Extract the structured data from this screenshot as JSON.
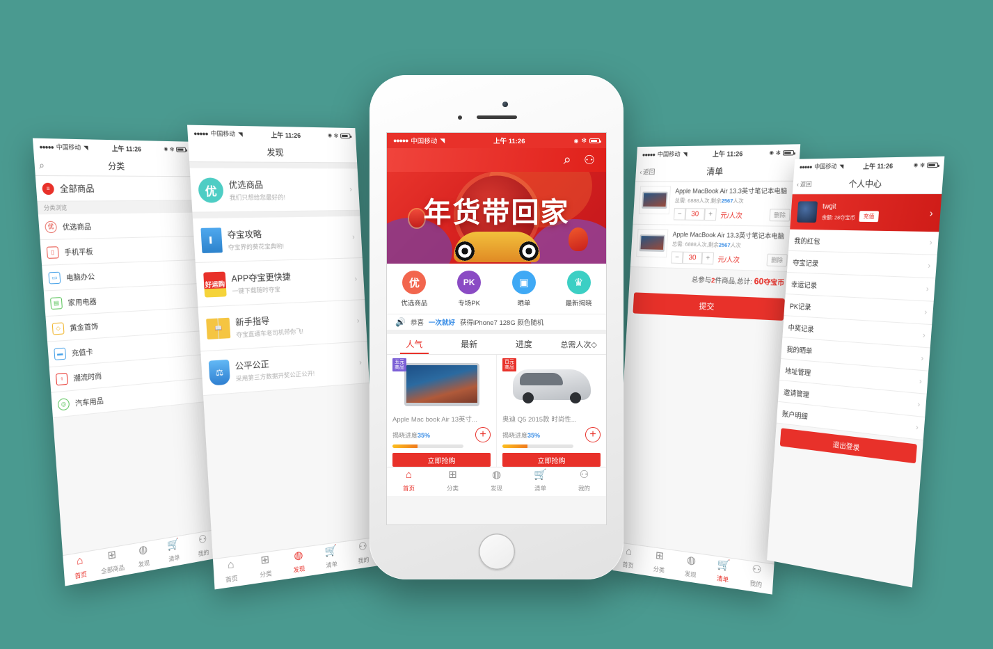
{
  "background_color": "#4a9a90",
  "accent_color": "#e8312a",
  "status_bar": {
    "signal_dots": "●●●●●",
    "carrier": "中国移动",
    "wifi_icon": "wifi-icon",
    "time": "上午 11:26",
    "alarm_icon": "alarm-icon",
    "bluetooth_icon": "bluetooth-icon",
    "battery_icon": "battery-icon"
  },
  "screen_category": {
    "title": "分类",
    "search_icon": "search-icon",
    "all_products": {
      "label": "全部商品",
      "icon": "list-icon"
    },
    "section_header": "分类浏览",
    "items": [
      {
        "label": "优选商品",
        "icon": "you-badge-icon",
        "color": "#e8726a"
      },
      {
        "label": "手机平板",
        "icon": "phone-icon",
        "color": "#e8554a"
      },
      {
        "label": "电脑办公",
        "icon": "monitor-icon",
        "color": "#4aa3e8"
      },
      {
        "label": "家用电器",
        "icon": "appliance-icon",
        "color": "#5cc45c"
      },
      {
        "label": "黄金首饰",
        "icon": "diamond-icon",
        "color": "#f0b429"
      },
      {
        "label": "充值卡",
        "icon": "card-icon",
        "color": "#4aa3e8"
      },
      {
        "label": "潮流时尚",
        "icon": "fashion-icon",
        "color": "#e8312a"
      },
      {
        "label": "汽车用品",
        "icon": "wheel-icon",
        "color": "#5cc45c"
      }
    ],
    "tabbar": [
      {
        "label": "首页",
        "icon": "home-icon",
        "active": true
      },
      {
        "label": "全部商品",
        "icon": "grid-icon",
        "active": false
      },
      {
        "label": "发现",
        "icon": "discover-icon",
        "active": false
      },
      {
        "label": "清单",
        "icon": "cart-icon",
        "active": false
      },
      {
        "label": "我的",
        "icon": "person-icon",
        "active": false
      }
    ]
  },
  "screen_discover": {
    "title": "发现",
    "items": [
      {
        "title": "优选商品",
        "subtitle": "我们只想给您最好的!",
        "icon": "you-circle-icon",
        "color": "#4ecdc4"
      },
      {
        "title": "夺宝攻略",
        "subtitle": "夺宝界的葵花宝典哟!",
        "icon": "book-icon",
        "color": "#3d9be9"
      },
      {
        "title": "APP夺宝更快捷",
        "subtitle": "一键下载随时夺宝",
        "icon": "app-icon",
        "color": "#e8312a"
      },
      {
        "title": "新手指导",
        "subtitle": "夺宝直通车老司机带你飞!",
        "icon": "open-book-icon",
        "color": "#f0b429"
      },
      {
        "title": "公平公正",
        "subtitle": "采用第三方数据开奖公正公开!",
        "icon": "shield-scale-icon",
        "color": "#3d9be9"
      }
    ],
    "tabbar": [
      {
        "label": "首页",
        "icon": "home-icon",
        "active": false
      },
      {
        "label": "分类",
        "icon": "grid-icon",
        "active": false
      },
      {
        "label": "发现",
        "icon": "discover-icon",
        "active": true
      },
      {
        "label": "清单",
        "icon": "cart-icon",
        "active": false
      },
      {
        "label": "我的",
        "icon": "person-icon",
        "active": false
      }
    ]
  },
  "screen_home": {
    "search_icon": "search-icon",
    "account_icon": "person-icon",
    "banner": {
      "title": "年货带回家",
      "lantern_icon": "lantern-icon",
      "rooster_icon": "rooster-icon",
      "lion_icon": "lion-mask-icon"
    },
    "quick_links": [
      {
        "label": "优选商品",
        "glyph": "优",
        "color": "#f2664e",
        "icon": "you-circle-icon"
      },
      {
        "label": "专场PK",
        "glyph": "PK",
        "color": "#8a4bc4",
        "icon": "pk-circle-icon"
      },
      {
        "label": "晒单",
        "glyph": "▣",
        "color": "#3fa9f5",
        "icon": "photo-circle-icon"
      },
      {
        "label": "最新揭晓",
        "glyph": "♛",
        "color": "#3ccfc4",
        "icon": "crown-circle-icon"
      }
    ],
    "notice": {
      "speaker_icon": "speaker-icon",
      "prefix": "恭喜",
      "highlight": "一次就好",
      "suffix": "获得iPhone7 128G 颜色随机"
    },
    "tabs": [
      {
        "label": "人气",
        "active": true
      },
      {
        "label": "最新",
        "active": false
      },
      {
        "label": "进度",
        "active": false
      },
      {
        "label": "总需人次◇",
        "active": false
      }
    ],
    "products": [
      {
        "badge": "五元商品",
        "badge_color": "#7b5fd6",
        "name": "Apple Mac book Air 13英寸...",
        "progress_label": "揭晓进度",
        "progress_pct": "35%",
        "progress_value": 35,
        "buy_label": "立即抢购",
        "image": "laptop-image",
        "plus_icon": "plus-icon"
      },
      {
        "badge": "百元商品",
        "badge_color": "#e8312a",
        "name": "奥迪 Q5 2015款 时尚性...",
        "progress_label": "揭晓进度",
        "progress_pct": "35%",
        "progress_value": 35,
        "buy_label": "立即抢购",
        "image": "car-image",
        "plus_icon": "plus-icon"
      }
    ],
    "tabbar": [
      {
        "label": "首页",
        "icon": "home-icon",
        "active": true
      },
      {
        "label": "分类",
        "icon": "grid-icon",
        "active": false
      },
      {
        "label": "发现",
        "icon": "discover-icon",
        "active": false
      },
      {
        "label": "清单",
        "icon": "cart-icon",
        "active": false
      },
      {
        "label": "我的",
        "icon": "person-icon",
        "active": false
      }
    ]
  },
  "screen_cart": {
    "title": "清单",
    "back_label": "返回",
    "back_icon": "chevron-left-icon",
    "items": [
      {
        "name": "Apple MacBook Air 13.3英寸笔记本电脑",
        "meta_prefix": "总需: 6888人次,剩余",
        "meta_remaining": "2567",
        "meta_suffix": "人次",
        "quantity": "30",
        "minus_label": "−",
        "plus_label": "+",
        "unit": "元/人次",
        "delete_label": "删除",
        "image": "laptop-image"
      },
      {
        "name": "Apple MacBook Air 13.3英寸笔记本电脑",
        "meta_prefix": "总需: 6888人次,剩余",
        "meta_remaining": "2567",
        "meta_suffix": "人次",
        "quantity": "30",
        "minus_label": "−",
        "plus_label": "+",
        "unit": "元/人次",
        "delete_label": "删除",
        "image": "laptop-image"
      }
    ],
    "total_prefix": "总参与",
    "total_count": "2",
    "total_mid": "件商品,总计:",
    "total_amount": "60",
    "total_unit": "夺宝币",
    "submit_label": "提交",
    "tabbar": [
      {
        "label": "首页",
        "icon": "home-icon",
        "active": false
      },
      {
        "label": "分类",
        "icon": "grid-icon",
        "active": false
      },
      {
        "label": "发现",
        "icon": "discover-icon",
        "active": false
      },
      {
        "label": "清单",
        "icon": "cart-icon",
        "active": true
      },
      {
        "label": "我的",
        "icon": "person-icon",
        "active": false
      }
    ]
  },
  "screen_profile": {
    "title": "个人中心",
    "back_label": "返回",
    "username": "twgit",
    "balance_label": "余额: 28夺宝币",
    "recharge_label": "充值",
    "avatar_icon": "avatar",
    "chevron_icon": "chevron-right-icon",
    "items": [
      {
        "label": "我的红包"
      },
      {
        "label": "夺宝记录"
      },
      {
        "label": "幸运记录"
      },
      {
        "label": "PK记录"
      },
      {
        "label": "中奖记录"
      },
      {
        "label": "我的晒单"
      },
      {
        "label": "地址管理"
      },
      {
        "label": "邀请管理"
      },
      {
        "label": "账户明细"
      }
    ],
    "logout_label": "退出登录"
  }
}
